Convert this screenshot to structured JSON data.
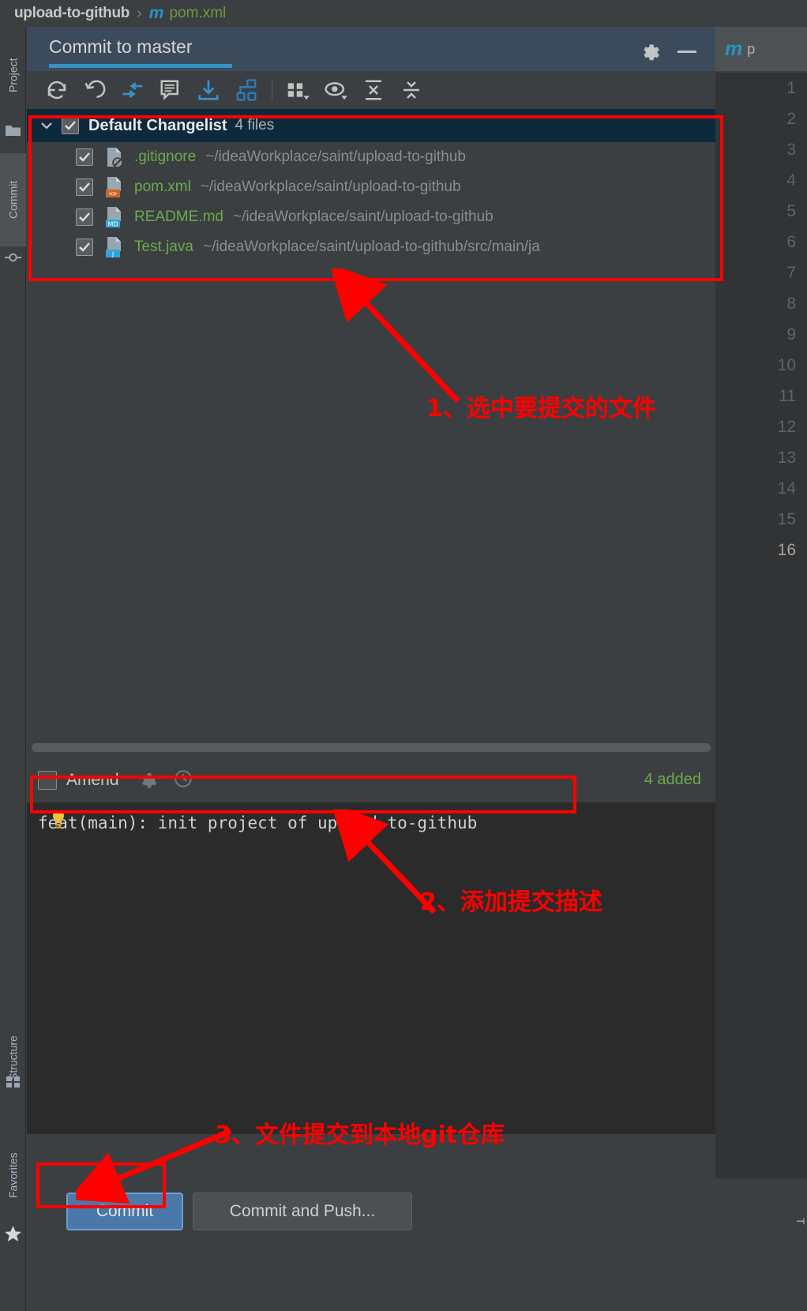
{
  "breadcrumb": {
    "project": "upload-to-github",
    "separator": "›",
    "file_icon": "m",
    "file": "pom.xml"
  },
  "left_strip": {
    "tabs": [
      {
        "label": "Project",
        "icon": "folder-icon",
        "selected": false
      },
      {
        "label": "Commit",
        "icon": "commit-icon",
        "selected": true
      },
      {
        "label": "Structure",
        "icon": "structure-icon",
        "selected": false
      },
      {
        "label": "Favorites",
        "icon": "star-icon",
        "selected": false
      }
    ]
  },
  "commit_window": {
    "title": "Commit to master",
    "gear_icon": "gear-icon",
    "minimize_icon": "minimize-icon",
    "toolbar": [
      {
        "name": "refresh-icon",
        "tooltip": "Refresh"
      },
      {
        "name": "rollback-icon",
        "tooltip": "Rollback"
      },
      {
        "name": "show-diff-icon",
        "tooltip": "Show Diff"
      },
      {
        "name": "commit-message-icon",
        "tooltip": "Commit Message History"
      },
      {
        "name": "update-project-icon",
        "tooltip": "Update Project"
      },
      {
        "name": "branches-icon",
        "tooltip": "Branches"
      },
      {
        "name": "group-by-icon",
        "tooltip": "Group By"
      },
      {
        "name": "preview-diff-icon",
        "tooltip": "Preview Diff"
      },
      {
        "name": "expand-all-icon",
        "tooltip": "Expand All"
      },
      {
        "name": "collapse-all-icon",
        "tooltip": "Collapse All"
      }
    ],
    "changelist": {
      "name": "Default Changelist",
      "count": "4 files",
      "checked": true,
      "expanded": true
    },
    "files": [
      {
        "name": ".gitignore",
        "path": "~/ideaWorkplace/saint/upload-to-github",
        "icon": "gitignore-file-icon",
        "badge": "",
        "badge_color": "#6e7b85",
        "checked": true
      },
      {
        "name": "pom.xml",
        "path": "~/ideaWorkplace/saint/upload-to-github",
        "icon": "xml-file-icon",
        "badge": "<>",
        "badge_color": "#cc6626",
        "checked": true
      },
      {
        "name": "README.md",
        "path": "~/ideaWorkplace/saint/upload-to-github",
        "icon": "markdown-file-icon",
        "badge": "MD",
        "badge_color": "#2fa5d6",
        "checked": true
      },
      {
        "name": "Test.java",
        "path": "~/ideaWorkplace/saint/upload-to-github/src/main/ja",
        "icon": "java-file-icon",
        "badge": "J",
        "badge_color": "#2fa5d6",
        "checked": true
      }
    ],
    "amend": {
      "label": "Amend",
      "checked": false,
      "gear_icon": "gear-icon",
      "history_icon": "clock-icon"
    },
    "added_count": "4 added",
    "commit_message": "feat(main): init project of upload-to-github",
    "bulb_icon": "lightbulb-icon",
    "buttons": {
      "commit": "Commit",
      "commit_and_push": "Commit and Push..."
    }
  },
  "editor": {
    "tab_icon": "m",
    "tab_file": "p",
    "line_numbers": [
      "1",
      "2",
      "3",
      "4",
      "5",
      "6",
      "7",
      "8",
      "9",
      "10",
      "11",
      "12",
      "13",
      "14",
      "15",
      "16"
    ],
    "current_line": "16",
    "side_tab": "T"
  },
  "annotations": [
    {
      "id": 1,
      "text": "1、选中要提交的文件"
    },
    {
      "id": 2,
      "text": "2、添加提交描述"
    },
    {
      "id": 3,
      "text": "3、文件提交到本地git仓库"
    }
  ],
  "colors": {
    "annotation": "#ff0000",
    "accent": "#3592c4",
    "added": "#6aab4a",
    "selected_row": "#0d2a3d"
  }
}
